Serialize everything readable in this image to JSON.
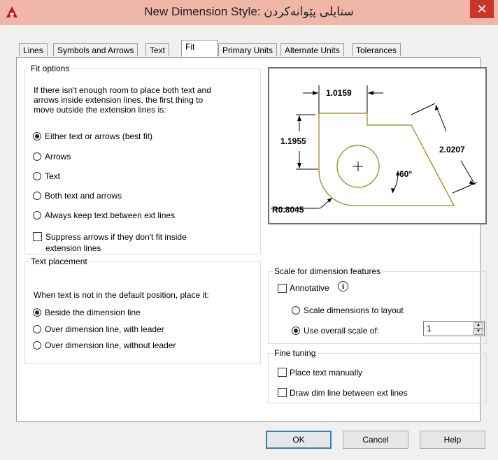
{
  "window": {
    "title": "New Dimension Style: ستایلی پێوانەکردن",
    "close_glyph": "✕"
  },
  "tabs": [
    {
      "label": "Lines"
    },
    {
      "label": "Symbols and Arrows"
    },
    {
      "label": "Text"
    },
    {
      "label": "Fit",
      "active": true
    },
    {
      "label": "Primary Units"
    },
    {
      "label": "Alternate Units"
    },
    {
      "label": "Tolerances"
    }
  ],
  "fit_options": {
    "legend": "Fit options",
    "intro_lines": [
      "If there isn't enough room to place both text and",
      "arrows inside extension lines, the first thing to",
      "move outside the extension lines is:"
    ],
    "options": [
      {
        "label": "Either text or arrows (best fit)",
        "selected": true
      },
      {
        "label": "Arrows",
        "selected": false
      },
      {
        "label": "Text",
        "selected": false
      },
      {
        "label": "Both text and arrows",
        "selected": false
      },
      {
        "label": "Always keep text between ext lines",
        "selected": false
      }
    ],
    "suppress_lines": [
      "Suppress arrows if they don't fit inside",
      "extension lines"
    ],
    "suppress_checked": false
  },
  "text_placement": {
    "legend": "Text placement",
    "intro": "When text is not in the default position, place it:",
    "options": [
      {
        "label": "Beside the dimension line",
        "selected": true
      },
      {
        "label": "Over dimension line, with leader",
        "selected": false
      },
      {
        "label": "Over dimension line, without leader",
        "selected": false
      }
    ]
  },
  "preview": {
    "dim_top": "1.0159",
    "dim_left": "1.1955",
    "dim_right": "2.0207",
    "dim_angle": "60°",
    "dim_radius": "R0.8045"
  },
  "scale": {
    "legend": "Scale for dimension features",
    "annotative_label": "Annotative",
    "annotative_checked": false,
    "info_glyph": "i",
    "layout_label": "Scale dimensions to layout",
    "overall_label": "Use overall scale of:",
    "overall_selected": true,
    "overall_value": "1"
  },
  "fine_tuning": {
    "legend": "Fine tuning",
    "manual_label": "Place text manually",
    "manual_checked": false,
    "dimline_label": "Draw dim line between ext lines",
    "dimline_checked": false
  },
  "buttons": {
    "ok": "OK",
    "cancel": "Cancel",
    "help": "Help"
  },
  "colors": {
    "titlebar": "#f0b6a7",
    "close": "#c9342b",
    "outline": "#a08000"
  }
}
